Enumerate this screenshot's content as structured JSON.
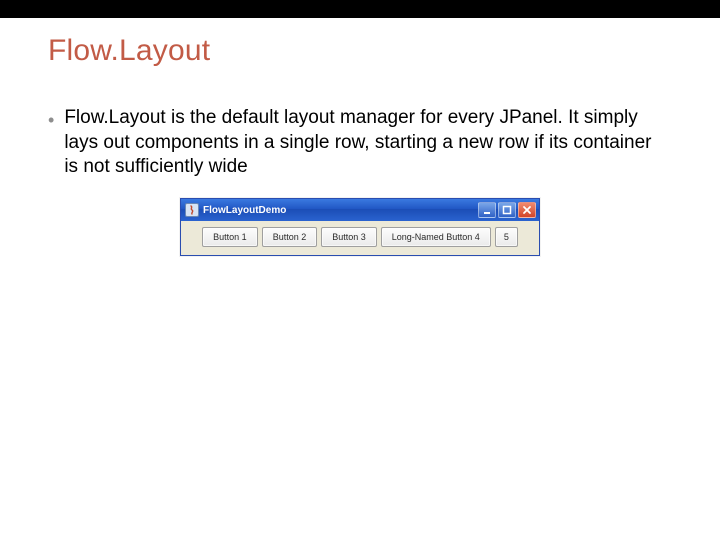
{
  "slide": {
    "title": "Flow.Layout",
    "bullet_glyph": "•",
    "body": "Flow.Layout is the default layout manager for every JPanel. It simply lays out components in a single row, starting a new row if its container is not sufficiently wide"
  },
  "demo_window": {
    "title": "FlowLayoutDemo",
    "buttons": {
      "b1": "Button 1",
      "b2": "Button 2",
      "b3": "Button 3",
      "b4": "Long-Named Button 4",
      "b5": "5"
    }
  }
}
